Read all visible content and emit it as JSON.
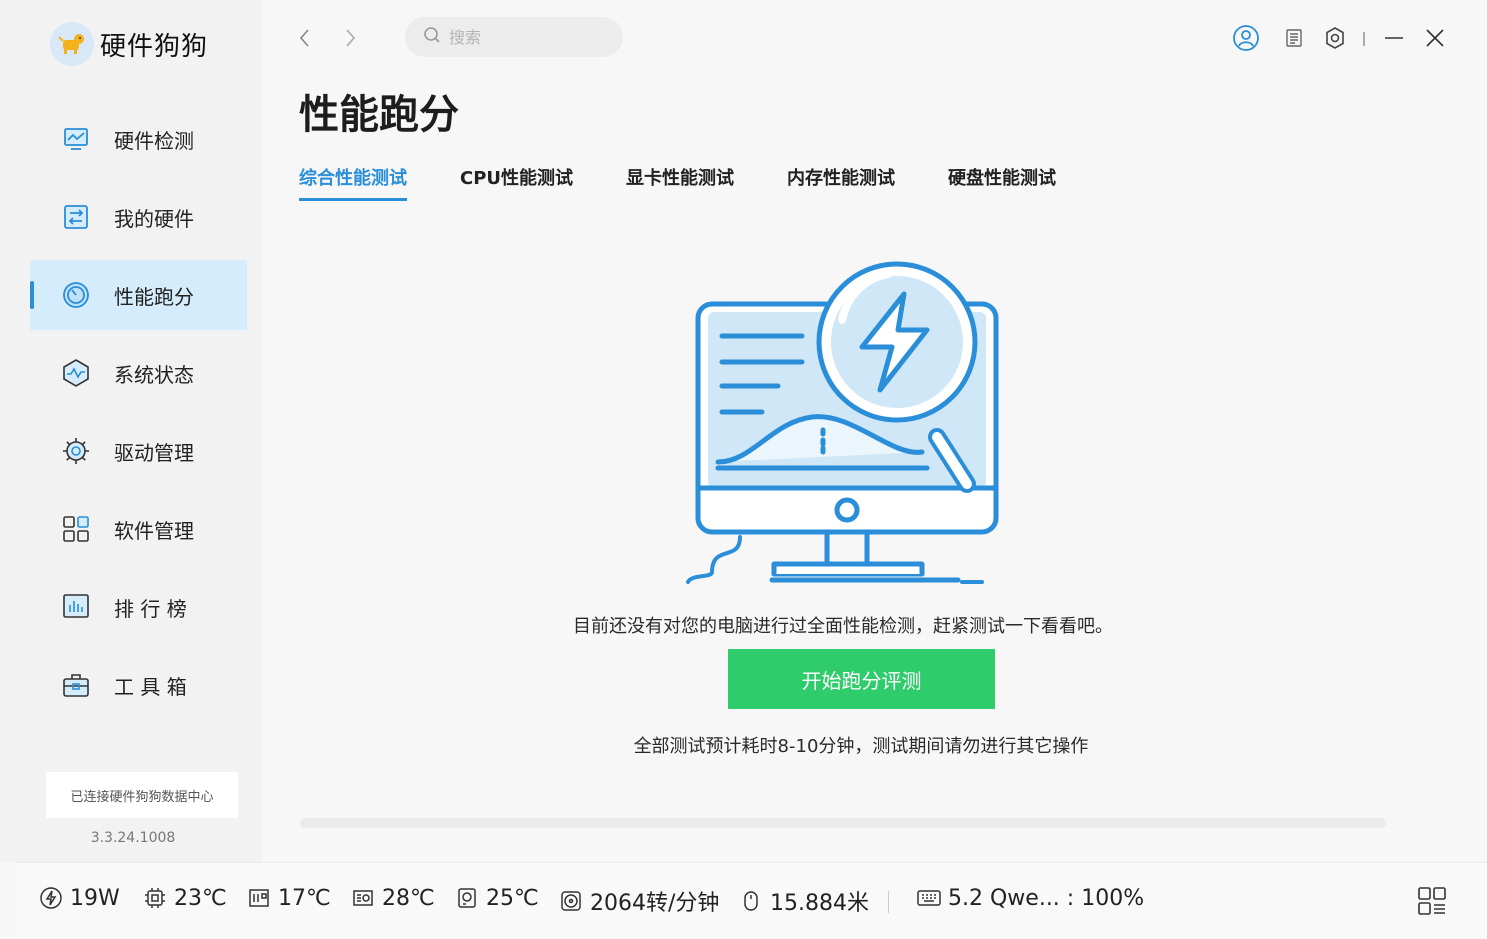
{
  "app": {
    "name": "硬件狗狗"
  },
  "sidebar": {
    "items": [
      {
        "label": "硬件检测",
        "icon": "monitor-chart-icon",
        "active": false
      },
      {
        "label": "我的硬件",
        "icon": "swap-board-icon",
        "active": false
      },
      {
        "label": "性能跑分",
        "icon": "speedometer-icon",
        "active": true
      },
      {
        "label": "系统状态",
        "icon": "hexagon-pulse-icon",
        "active": false
      },
      {
        "label": "驱动管理",
        "icon": "gear-icon",
        "active": false
      },
      {
        "label": "软件管理",
        "icon": "grid-apps-icon",
        "active": false
      },
      {
        "label": "排 行 榜",
        "icon": "bar-chart-icon",
        "active": false
      },
      {
        "label": "工 具 箱",
        "icon": "toolbox-icon",
        "active": false
      }
    ],
    "connection_status": "已连接硬件狗狗数据中心",
    "version": "3.3.24.1008"
  },
  "search": {
    "placeholder": "搜索"
  },
  "page": {
    "title": "性能跑分",
    "tabs": [
      {
        "label": "综合性能测试",
        "active": true
      },
      {
        "label": "CPU性能测试",
        "active": false
      },
      {
        "label": "显卡性能测试",
        "active": false
      },
      {
        "label": "内存性能测试",
        "active": false
      },
      {
        "label": "硬盘性能测试",
        "active": false
      }
    ],
    "message": "目前还没有对您的电脑进行过全面性能检测，赶紧测试一下看看吧。",
    "start_button": "开始跑分评测",
    "note": "全部测试预计耗时8-10分钟，测试期间请勿进行其它操作",
    "progress": 0
  },
  "statusbar": {
    "power": "19W",
    "cpu_temp": "23℃",
    "board_temp": "17℃",
    "gpu_temp": "28℃",
    "disk_temp": "25℃",
    "fan_speed": "2064转/分钟",
    "mouse_distance": "15.884米",
    "keyboard": "5.2 Qwe... : 100%"
  },
  "colors": {
    "accent": "#2a8ed8",
    "active_bg": "#d4ecfb",
    "button_green": "#2ecc6a"
  }
}
